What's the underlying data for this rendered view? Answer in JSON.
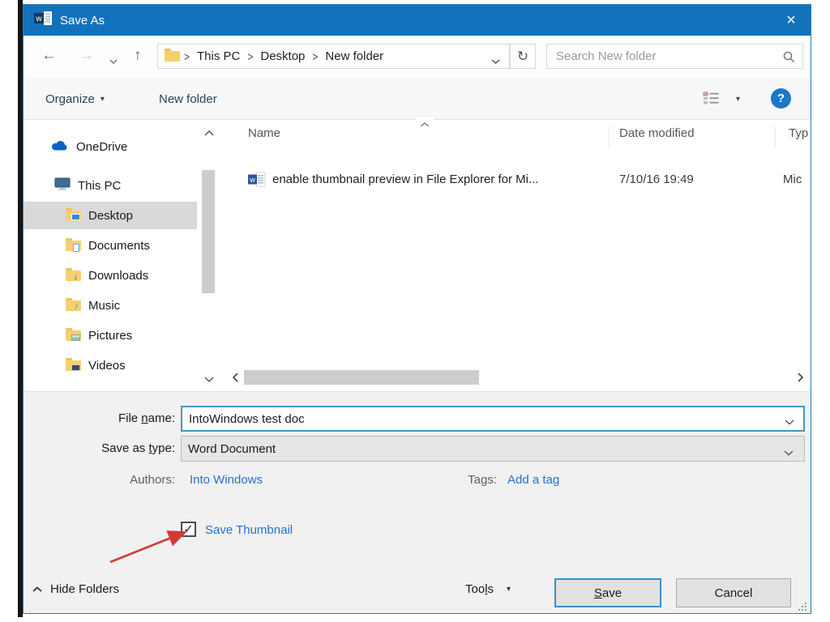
{
  "glyphs": {
    "close": "×",
    "back": "←",
    "forward": "→",
    "up": "↑",
    "refresh": "↻",
    "caret_solid": "▾",
    "help": "?",
    "check": "✓",
    "breadcrumb_sep": ">",
    "downloads_overlay": "↓",
    "music_overlay": "♪"
  },
  "titlebar": {
    "title": "Save As"
  },
  "nav": {
    "breadcrumb_items": [
      "This PC",
      "Desktop",
      "New folder"
    ],
    "search_placeholder": "Search New folder"
  },
  "toolbar": {
    "organize_label": "Organize",
    "new_folder_label": "New folder"
  },
  "sidebar": {
    "items": [
      {
        "label": "OneDrive",
        "icon": "onedrive-icon",
        "selected": false
      },
      {
        "label": "This PC",
        "icon": "this-pc-icon",
        "selected": false
      },
      {
        "label": "Desktop",
        "icon": "folder-desktop-icon",
        "selected": true
      },
      {
        "label": "Documents",
        "icon": "folder-documents-icon",
        "selected": false
      },
      {
        "label": "Downloads",
        "icon": "folder-downloads-icon",
        "selected": false
      },
      {
        "label": "Music",
        "icon": "folder-music-icon",
        "selected": false
      },
      {
        "label": "Pictures",
        "icon": "folder-pictures-icon",
        "selected": false
      },
      {
        "label": "Videos",
        "icon": "folder-videos-icon",
        "selected": false
      }
    ]
  },
  "file_list": {
    "columns": {
      "name": "Name",
      "date_modified": "Date modified",
      "type": "Typ"
    },
    "rows": [
      {
        "name": "enable thumbnail preview in File Explorer for Mi...",
        "date_modified": "7/10/16 19:49",
        "type": "Mic"
      }
    ]
  },
  "fields": {
    "file_name": {
      "label_pre": "File ",
      "mnemonic": "n",
      "label_post": "ame:",
      "value": "IntoWindows test doc"
    },
    "save_as_type": {
      "label_pre": "Save as ",
      "mnemonic": "t",
      "label_post": "ype:",
      "value": "Word Document"
    },
    "authors": {
      "label": "Authors:",
      "value": "Into Windows"
    },
    "tags": {
      "label": "Tags:",
      "value": "Add a tag"
    },
    "save_thumbnail": {
      "label": "Save Thumbnail",
      "checked": true
    }
  },
  "footer": {
    "hide_folders_label": "Hide Folders",
    "tools": {
      "label_pre": "Too",
      "mnemonic": "l",
      "label_post": "s"
    },
    "save": {
      "label_pre": "",
      "mnemonic": "S",
      "label_post": "ave"
    },
    "cancel_label": "Cancel"
  },
  "colors": {
    "titlebar_bg": "#1273bc",
    "window_border": "#2e7cba",
    "toolbar_text": "#29425f",
    "link_blue": "#2470cf",
    "selection_bg": "#d9d9d9",
    "focus_border": "#4596c6",
    "annotation_red": "#d23b34",
    "folder_yellow": "#f7cf6e",
    "word_blue": "#2b579a",
    "help_bg": "#1c78c8"
  }
}
